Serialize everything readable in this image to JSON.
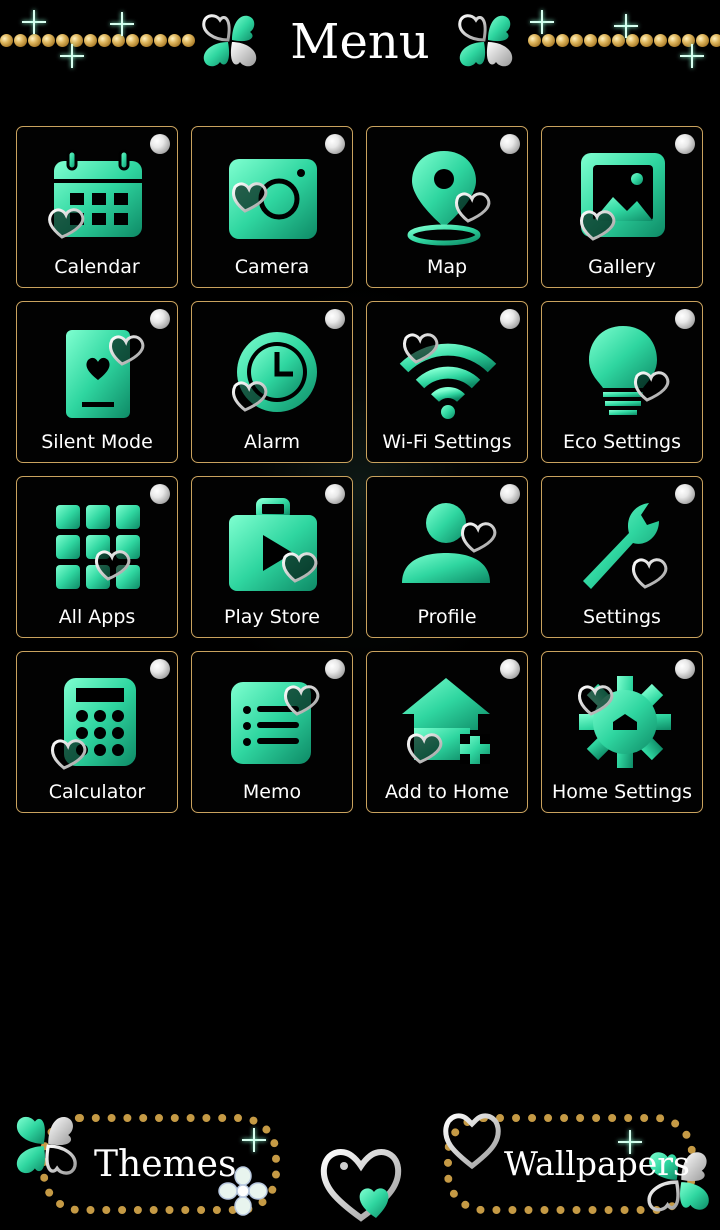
{
  "header": {
    "title": "Menu"
  },
  "colors": {
    "background": "#000000",
    "tile_border": "#c9a25e",
    "gem_green": "#2fd6a0",
    "gem_dark": "#0e8a66",
    "silver": "#d9d9d9",
    "gold": "#c59a45",
    "text": "#ffffff"
  },
  "menu": {
    "items": [
      {
        "label": "Calendar",
        "icon": "calendar-icon"
      },
      {
        "label": "Camera",
        "icon": "camera-icon"
      },
      {
        "label": "Map",
        "icon": "map-pin-icon"
      },
      {
        "label": "Gallery",
        "icon": "gallery-icon"
      },
      {
        "label": "Silent Mode",
        "icon": "silent-mode-icon"
      },
      {
        "label": "Alarm",
        "icon": "clock-icon"
      },
      {
        "label": "Wi-Fi Settings",
        "icon": "wifi-icon"
      },
      {
        "label": "Eco Settings",
        "icon": "lightbulb-icon"
      },
      {
        "label": "All Apps",
        "icon": "grid-icon"
      },
      {
        "label": "Play Store",
        "icon": "shopping-bag-play-icon"
      },
      {
        "label": "Profile",
        "icon": "person-icon"
      },
      {
        "label": "Settings",
        "icon": "wrench-icon"
      },
      {
        "label": "Calculator",
        "icon": "calculator-icon"
      },
      {
        "label": "Memo",
        "icon": "memo-list-icon"
      },
      {
        "label": "Add to Home",
        "icon": "home-plus-icon"
      },
      {
        "label": "Home Settings",
        "icon": "gear-icon"
      }
    ]
  },
  "footer": {
    "themes_label": "Themes",
    "wallpapers_label": "Wallpapers"
  }
}
